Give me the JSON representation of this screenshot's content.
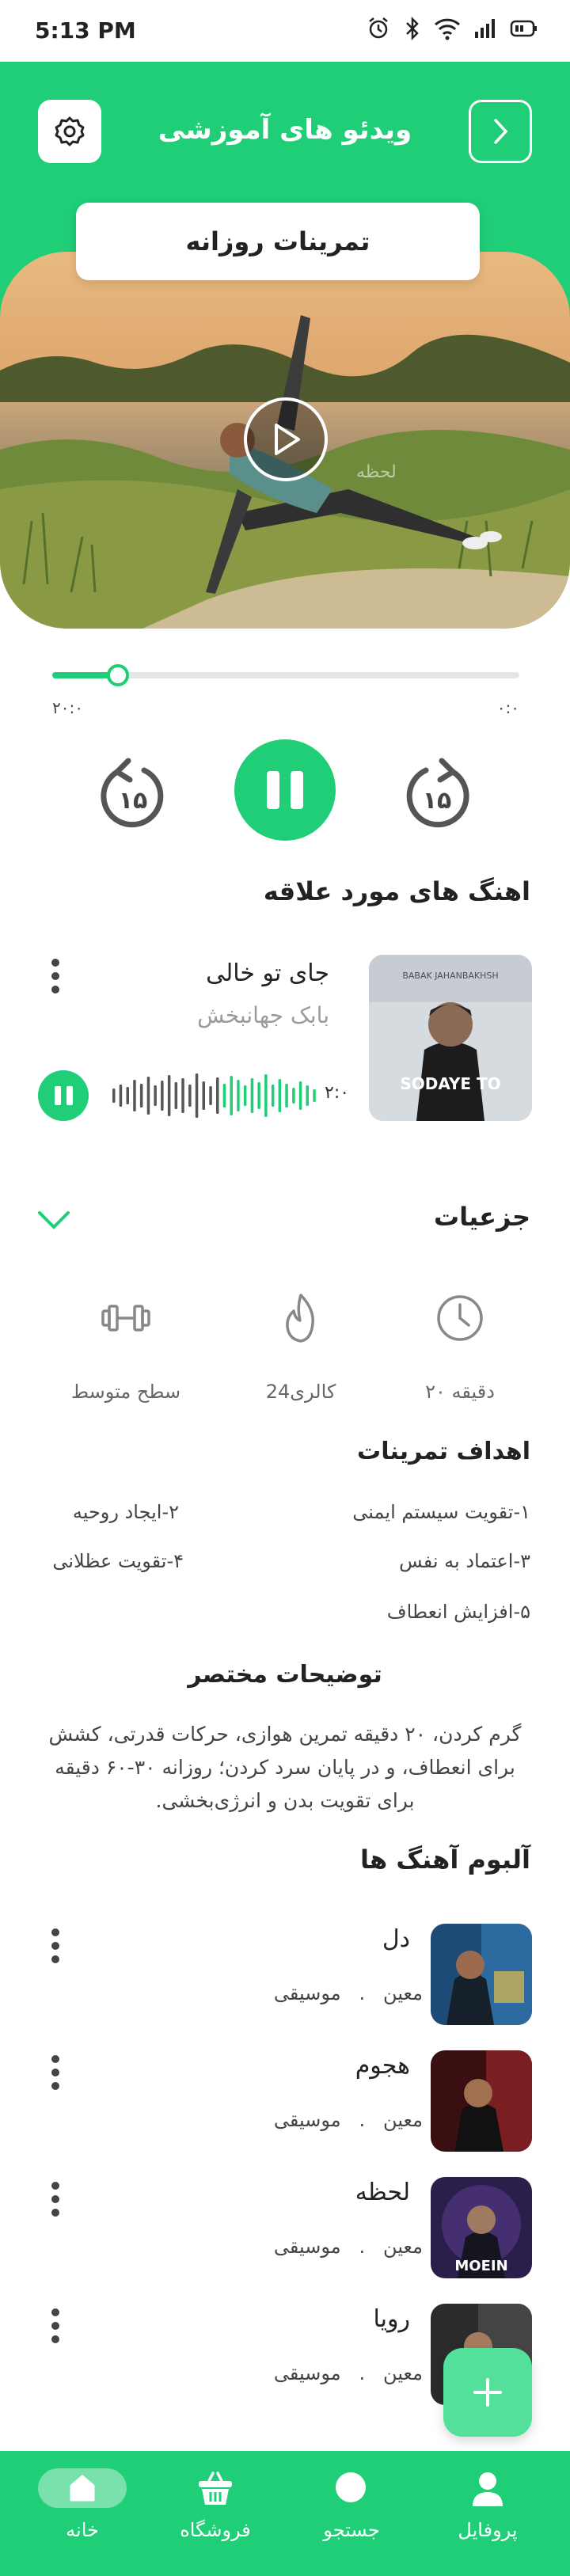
{
  "status_bar": {
    "time": "5:13 PM"
  },
  "header": {
    "title": "ویدئو های آموزشی"
  },
  "video": {
    "tab_label": "تمرینات روزانه",
    "watermark": "لحظه"
  },
  "player": {
    "progress": 0.14,
    "time_total": "۲۰:۰",
    "time_current": "۰:۰",
    "rewind_label": "۱۵",
    "forward_label": "۱۵"
  },
  "favorites": {
    "title": "اهنگ های مورد علاقه",
    "track": {
      "song": "جای تو خالی",
      "artist": "بابک جهانبخش",
      "time": "۲:۰",
      "cover_text": "SODAYE TO",
      "cover_top_text": "BABAK JAHANBAKHSH"
    }
  },
  "details": {
    "title": "جزعیات",
    "stats": [
      {
        "icon": "clock-icon",
        "label": "۲۰ دقیقه"
      },
      {
        "icon": "flame-icon",
        "label": "24کالری"
      },
      {
        "icon": "dumbbell-icon",
        "label": "سطح متوسط"
      }
    ],
    "goals_title": "اهداف تمرینات",
    "goals": [
      "۱-تقویت سیستم ایمنی",
      "۲-ایجاد روحیه",
      "۳-اعتماد به نفس",
      "۴-تقویت عظلانی",
      "۵-افزایش انعطاف"
    ],
    "summary_title": "توضیحات مختصر",
    "summary": "گرم کردن، ۲۰ دقیقه تمرین هوازی، حرکات قدرتی، کشش برای انعطاف، و در پایان سرد کردن؛ روزانه ۳۰-۶۰ دقیقه برای تقویت بدن و انرژی‌بخشی."
  },
  "album": {
    "title": "آلبوم آهنگ ها",
    "tracks": [
      {
        "song": "دل",
        "artist": "معین",
        "sep": ".",
        "genre": "موسیقی"
      },
      {
        "song": "هجوم",
        "artist": "معین",
        "sep": ".",
        "genre": "موسیقی"
      },
      {
        "song": "لحظه",
        "artist": "معین",
        "sep": ".",
        "genre": "موسیقی"
      },
      {
        "song": "رویا",
        "artist": "معین",
        "sep": ".",
        "genre": "موسیقی"
      }
    ]
  },
  "nav": {
    "items": [
      {
        "label": "پروفایل",
        "icon": "user-icon"
      },
      {
        "label": "جستجو",
        "icon": "search-icon"
      },
      {
        "label": "فروشگاه",
        "icon": "basket-icon"
      },
      {
        "label": "خانه",
        "icon": "home-icon"
      }
    ]
  },
  "colors": {
    "accent": "#1fce76",
    "fab": "#52e09a"
  }
}
